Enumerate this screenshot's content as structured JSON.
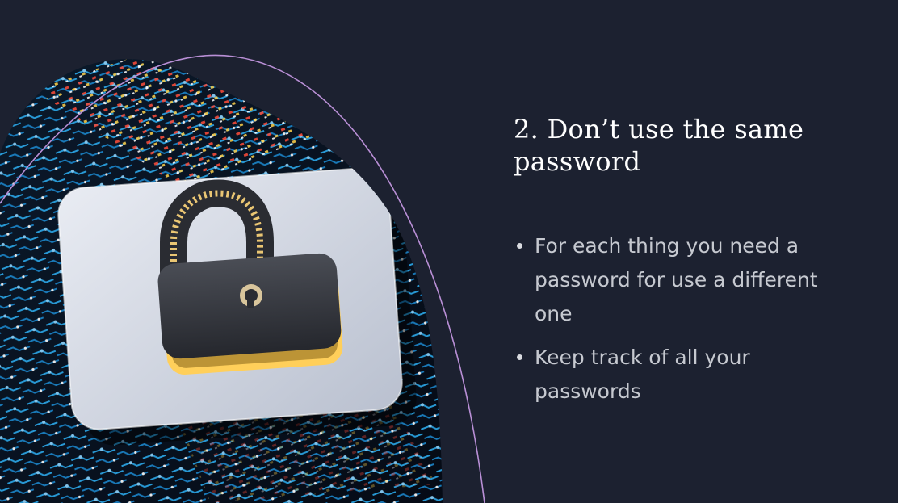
{
  "slide": {
    "title": "2. Don’t use the same password",
    "bullets": [
      "For each thing you need a password for use a different one",
      "Keep track of all your passwords"
    ],
    "image": {
      "icon": "padlock-icon",
      "background": "circuit-board"
    }
  },
  "colors": {
    "background": "#1c2130",
    "title": "#ffffff",
    "body_text": "#c6c9d0",
    "accent_curve": "#b98fd6",
    "circuit_blue": "#2ba7e8"
  }
}
